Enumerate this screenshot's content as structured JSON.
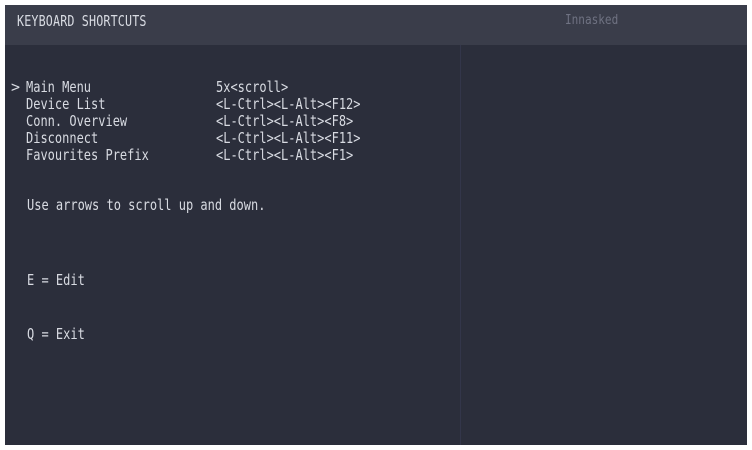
{
  "header": {
    "title": "KEYBOARD SHORTCUTS",
    "status": "Innasked"
  },
  "menu": {
    "selected_index": 0,
    "cursor": ">",
    "items": [
      {
        "label": "Main Menu",
        "shortcut": "5x<scroll>"
      },
      {
        "label": "Device List",
        "shortcut": "<L-Ctrl><L-Alt><F12>"
      },
      {
        "label": "Conn. Overview",
        "shortcut": "<L-Ctrl><L-Alt><F8>"
      },
      {
        "label": "Disconnect",
        "shortcut": "<L-Ctrl><L-Alt><F11>"
      },
      {
        "label": "Favourites Prefix",
        "shortcut": "<L-Ctrl><L-Alt><F1>"
      }
    ]
  },
  "hint": "Use arrows to scroll up and down.",
  "keys": {
    "edit": "E = Edit",
    "exit": "Q = Exit"
  },
  "colors": {
    "background": "#2b2e3b",
    "header_bar": "#3a3d4a",
    "text": "#d8dbe2",
    "status_text": "#6f7282"
  }
}
